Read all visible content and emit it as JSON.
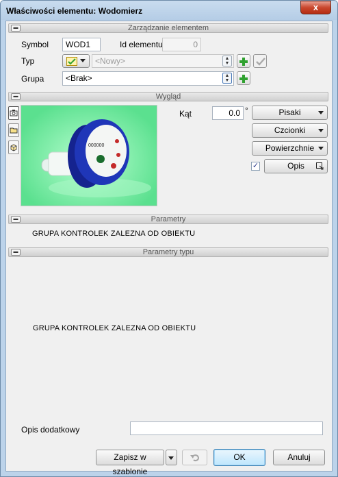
{
  "window": {
    "title": "Właściwości elementu: Wodomierz",
    "close_glyph": "x"
  },
  "sections": {
    "management": "Zarządzanie elementem",
    "appearance": "Wygląd",
    "parameters": "Parametry",
    "type_parameters": "Parametry typu"
  },
  "management": {
    "symbol_label": "Symbol",
    "symbol_value": "WOD1",
    "id_label": "Id elementu",
    "id_value": "0",
    "type_label": "Typ",
    "type_value": "<Nowy>",
    "group_label": "Grupa",
    "group_value": "<Brak>"
  },
  "appearance": {
    "angle_label": "Kąt",
    "angle_value": "0.0",
    "angle_unit": "°",
    "pens_button": "Pisaki",
    "fonts_button": "Czcionki",
    "surfaces_button": "Powierzchnie",
    "description_button": "Opis",
    "description_checked": true,
    "description_check_glyph": "✓",
    "side_tabs": [
      "camera-icon",
      "folder-icon",
      "box-icon"
    ]
  },
  "parameters": {
    "placeholder_text": "GRUPA KONTROLEK ZALEZNA OD OBIEKTU"
  },
  "type_parameters": {
    "placeholder_text": "GRUPA KONTROLEK ZALEZNA OD OBIEKTU"
  },
  "footer": {
    "extra_description_label": "Opis dodatkowy",
    "extra_description_value": "",
    "save_template_button": "Zapisz w szablonie",
    "ok_button": "OK",
    "cancel_button": "Anuluj"
  },
  "colors": {
    "accent_green": "#2fa12f",
    "preview_bg": "#7ff0a8",
    "meter_blue": "#1a2fa8"
  }
}
